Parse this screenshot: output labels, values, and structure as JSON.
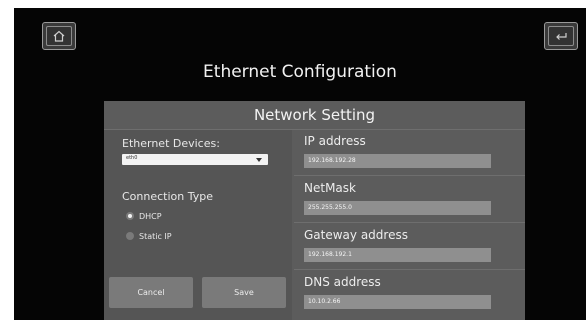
{
  "header": {
    "home_icon": "home-icon",
    "back_icon": "return-arrow-icon",
    "title": "Ethernet Configuration"
  },
  "panel": {
    "title": "Network Setting",
    "ethernet_devices": {
      "label": "Ethernet Devices:",
      "selected": "eth0"
    },
    "connection_type": {
      "label": "Connection Type",
      "options": [
        {
          "label": "DHCP",
          "selected": true
        },
        {
          "label": "Static IP",
          "selected": false
        }
      ]
    },
    "buttons": {
      "cancel": "Cancel",
      "save": "Save"
    },
    "fields": [
      {
        "label": "IP address",
        "value": "192.168.192.28"
      },
      {
        "label": "NetMask",
        "value": "255.255.255.0"
      },
      {
        "label": "Gateway address",
        "value": "192.168.192.1"
      },
      {
        "label": "DNS address",
        "value": "10.10.2.66"
      }
    ]
  },
  "colors": {
    "screen_bg": "#050505",
    "panel_bg": "#5c5c5c",
    "input_bg": "#8f8f8f",
    "button_bg": "#7a7a7a"
  }
}
